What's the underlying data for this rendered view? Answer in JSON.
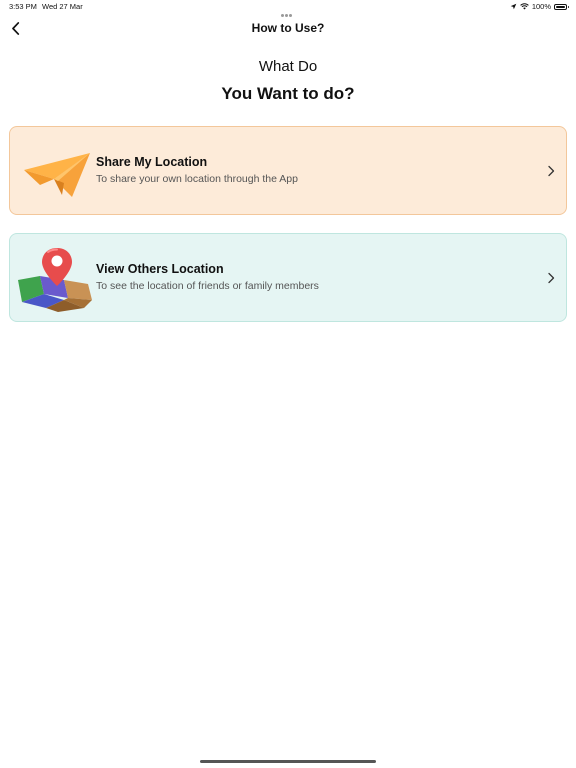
{
  "status_bar": {
    "time": "3:53 PM",
    "date": "Wed 27 Mar",
    "battery": "100%"
  },
  "nav": {
    "title": "How to Use?",
    "back_icon": "chevron-left-icon"
  },
  "heading": {
    "subtitle": "What Do",
    "title": "You Want to do?"
  },
  "options": [
    {
      "title": "Share My Location",
      "description": "To share your own location through the App",
      "icon": "paper-plane-icon",
      "background": "#fdebd9",
      "border": "#f3c79b"
    },
    {
      "title": "View Others Location",
      "description": "To see the location of friends or family members",
      "icon": "map-pin-icon",
      "background": "#e5f5f3",
      "border": "#bfe6df"
    }
  ]
}
